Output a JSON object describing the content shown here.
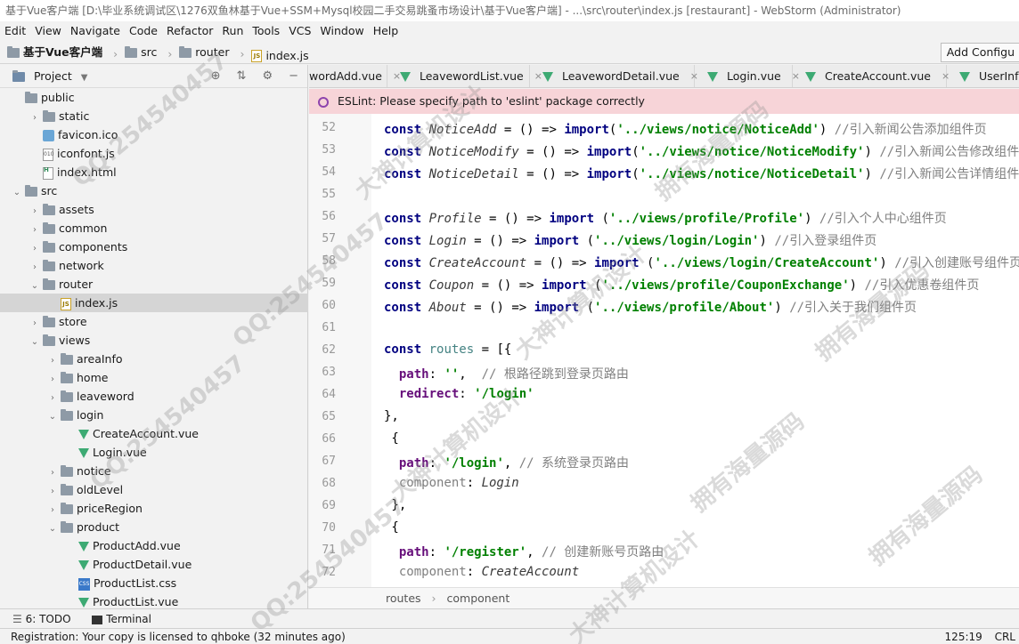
{
  "window": {
    "title": "基于Vue客户端 [D:\\毕业系统调试区\\1276双鱼林基于Vue+SSM+Mysql校园二手交易跳蚤市场设计\\基于Vue客户端] - ...\\src\\router\\index.js [restaurant] - WebStorm (Administrator)"
  },
  "menu": [
    "Edit",
    "View",
    "Navigate",
    "Code",
    "Refactor",
    "Run",
    "Tools",
    "VCS",
    "Window",
    "Help"
  ],
  "navbar": {
    "project": "基于Vue客户端",
    "src": "src",
    "router": "router",
    "file": "index.js",
    "add_config": "Add Configu"
  },
  "project_panel": {
    "title": "Project",
    "tree": [
      {
        "label": "public",
        "type": "folder",
        "depth": 0,
        "arrow": "",
        "icon": "folder-icon"
      },
      {
        "label": "static",
        "type": "folder",
        "depth": 1,
        "arrow": "›",
        "icon": "folder-icon"
      },
      {
        "label": "favicon.ico",
        "type": "ico",
        "depth": 1,
        "arrow": "",
        "icon": "image-file-icon"
      },
      {
        "label": "iconfont.js",
        "type": "tinyjs",
        "depth": 1,
        "arrow": "",
        "icon": "js-file-icon"
      },
      {
        "label": "index.html",
        "type": "html",
        "depth": 1,
        "arrow": "",
        "icon": "html-file-icon"
      },
      {
        "label": "src",
        "type": "folder",
        "depth": 0,
        "arrow": "⌄",
        "icon": "folder-icon"
      },
      {
        "label": "assets",
        "type": "folder",
        "depth": 1,
        "arrow": "›",
        "icon": "folder-icon"
      },
      {
        "label": "common",
        "type": "folder",
        "depth": 1,
        "arrow": "›",
        "icon": "folder-icon"
      },
      {
        "label": "components",
        "type": "folder",
        "depth": 1,
        "arrow": "›",
        "icon": "folder-icon"
      },
      {
        "label": "network",
        "type": "folder",
        "depth": 1,
        "arrow": "›",
        "icon": "folder-icon"
      },
      {
        "label": "router",
        "type": "folder",
        "depth": 1,
        "arrow": "⌄",
        "icon": "folder-icon"
      },
      {
        "label": "index.js",
        "type": "js",
        "depth": 2,
        "arrow": "",
        "icon": "js-file-icon",
        "selected": true
      },
      {
        "label": "store",
        "type": "folder",
        "depth": 1,
        "arrow": "›",
        "icon": "folder-icon"
      },
      {
        "label": "views",
        "type": "folder",
        "depth": 1,
        "arrow": "⌄",
        "icon": "folder-icon"
      },
      {
        "label": "areaInfo",
        "type": "folder",
        "depth": 2,
        "arrow": "›",
        "icon": "folder-icon"
      },
      {
        "label": "home",
        "type": "folder",
        "depth": 2,
        "arrow": "›",
        "icon": "folder-icon"
      },
      {
        "label": "leaveword",
        "type": "folder",
        "depth": 2,
        "arrow": "›",
        "icon": "folder-icon"
      },
      {
        "label": "login",
        "type": "folder",
        "depth": 2,
        "arrow": "⌄",
        "icon": "folder-icon"
      },
      {
        "label": "CreateAccount.vue",
        "type": "vue",
        "depth": 3,
        "arrow": "",
        "icon": "vue-file-icon"
      },
      {
        "label": "Login.vue",
        "type": "vue",
        "depth": 3,
        "arrow": "",
        "icon": "vue-file-icon"
      },
      {
        "label": "notice",
        "type": "folder",
        "depth": 2,
        "arrow": "›",
        "icon": "folder-icon"
      },
      {
        "label": "oldLevel",
        "type": "folder",
        "depth": 2,
        "arrow": "›",
        "icon": "folder-icon"
      },
      {
        "label": "priceRegion",
        "type": "folder",
        "depth": 2,
        "arrow": "›",
        "icon": "folder-icon"
      },
      {
        "label": "product",
        "type": "folder",
        "depth": 2,
        "arrow": "⌄",
        "icon": "folder-icon"
      },
      {
        "label": "ProductAdd.vue",
        "type": "vue",
        "depth": 3,
        "arrow": "",
        "icon": "vue-file-icon"
      },
      {
        "label": "ProductDetail.vue",
        "type": "vue",
        "depth": 3,
        "arrow": "",
        "icon": "vue-file-icon"
      },
      {
        "label": "ProductList.css",
        "type": "css",
        "depth": 3,
        "arrow": "",
        "icon": "css-file-icon"
      },
      {
        "label": "ProductList.vue",
        "type": "vue",
        "depth": 3,
        "arrow": "",
        "icon": "vue-file-icon"
      }
    ]
  },
  "editor_tabs": [
    {
      "label": "wordAdd.vue",
      "icon": "vue-file-icon"
    },
    {
      "label": "LeavewordList.vue",
      "icon": "vue-file-icon"
    },
    {
      "label": "LeavewordDetail.vue",
      "icon": "vue-file-icon"
    },
    {
      "label": "Login.vue",
      "icon": "vue-file-icon"
    },
    {
      "label": "CreateAccount.vue",
      "icon": "vue-file-icon"
    },
    {
      "label": "UserInfoM",
      "icon": "vue-file-icon"
    }
  ],
  "eslint_message": "ESLint: Please specify path to 'eslint' package correctly",
  "code_lines": [
    {
      "n": "52",
      "html": "<span class=\"kw\">const</span> <span class=\"fn\">NoticeAdd</span> = () => <span class=\"kw\">import</span>(<span class=\"str\">'../views/notice/NoticeAdd'</span>) <span class=\"cm\">//引入新闻公告添加组件页</span>"
    },
    {
      "n": "53",
      "html": "<span class=\"kw\">const</span> <span class=\"fn\">NoticeModify</span> = () => <span class=\"kw\">import</span>(<span class=\"str\">'../views/notice/NoticeModify'</span>) <span class=\"cm\">//引入新闻公告修改组件页</span>"
    },
    {
      "n": "54",
      "html": "<span class=\"kw\">const</span> <span class=\"fn\">NoticeDetail</span> = () => <span class=\"kw\">import</span>(<span class=\"str\">'../views/notice/NoticeDetail'</span>) <span class=\"cm\">//引入新闻公告详情组件页</span>"
    },
    {
      "n": "55",
      "html": ""
    },
    {
      "n": "56",
      "html": "<span class=\"kw\">const</span> <span class=\"fn\">Profile</span> = () => <span class=\"kw\">import</span> (<span class=\"str\">'../views/profile/Profile'</span>) <span class=\"cm\">//引入个人中心组件页</span>"
    },
    {
      "n": "57",
      "html": "<span class=\"kw\">const</span> <span class=\"fn\">Login</span> = () => <span class=\"kw\">import</span> (<span class=\"str\">'../views/login/Login'</span>) <span class=\"cm\">//引入登录组件页</span>"
    },
    {
      "n": "58",
      "html": "<span class=\"kw\">const</span> <span class=\"fn\">CreateAccount</span> = () => <span class=\"kw\">import</span> (<span class=\"str\">'../views/login/CreateAccount'</span>) <span class=\"cm\">//引入创建账号组件页</span>"
    },
    {
      "n": "59",
      "html": "<span class=\"kw\">const</span> <span class=\"fn\">Coupon</span> = () => <span class=\"kw\">import</span> (<span class=\"str\">'../views/profile/CouponExchange'</span>) <span class=\"cm\">//引入优惠卷组件页</span>"
    },
    {
      "n": "60",
      "html": "<span class=\"kw\">const</span> <span class=\"fn\">About</span> = () => <span class=\"kw\">import</span> (<span class=\"str\">'../views/profile/About'</span>) <span class=\"cm\">//引入关于我们组件页</span>"
    },
    {
      "n": "61",
      "html": ""
    },
    {
      "n": "62",
      "html": "<span class=\"kw\">const</span> <span class=\"var\">routes</span> = [{"
    },
    {
      "n": "63",
      "html": "  <span class=\"prop\">path</span>: <span class=\"str\">''</span>,  <span class=\"cm\">// 根路径跳到登录页路由</span>"
    },
    {
      "n": "64",
      "html": "  <span class=\"prop\">redirect</span>: <span class=\"str\">'/login'</span>"
    },
    {
      "n": "65",
      "html": "},"
    },
    {
      "n": "66",
      "html": " {"
    },
    {
      "n": "67",
      "html": "  <span class=\"prop\">path</span>: <span class=\"str\">'/login'</span>, <span class=\"cm\">// 系统登录页路由</span>"
    },
    {
      "n": "68",
      "html": "  <span class=\"cm\">component</span>: <span class=\"fn\">Login</span>"
    },
    {
      "n": "69",
      "html": " },"
    },
    {
      "n": "70",
      "html": " {"
    },
    {
      "n": "71",
      "html": "  <span class=\"prop\">path</span>: <span class=\"str\">'/register'</span>, <span class=\"cm\">// 创建新账号页路由</span>"
    },
    {
      "n": "72",
      "html": "  <span class=\"cm\">component</span>: <span class=\"fn\">CreateAccount</span>"
    }
  ],
  "code_crumbs": {
    "first": "routes",
    "second": "component"
  },
  "toolwindows": {
    "todo": "6: TODO",
    "terminal": "Terminal"
  },
  "status": {
    "message": "Registration: Your copy is licensed to qhboke (32 minutes ago)",
    "position": "125:19",
    "line_ending": "CRL"
  },
  "watermarks": [
    "QQ:254540457",
    "大神计算机设计",
    "拥有海量源码"
  ]
}
